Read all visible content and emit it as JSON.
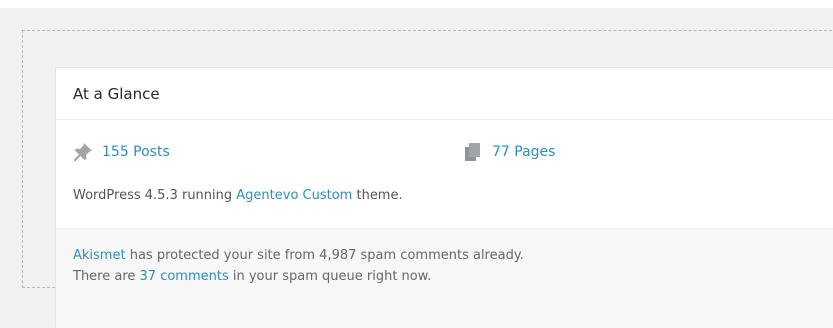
{
  "widget": {
    "title": "At a Glance",
    "posts": {
      "label": "155 Posts",
      "icon": "pushpin-icon"
    },
    "pages": {
      "label": "77 Pages",
      "icon": "pages-icon"
    },
    "version": {
      "prefix": "WordPress 4.5.3 running ",
      "theme_link": "Agentevo Custom",
      "suffix": " theme."
    },
    "akismet": {
      "line1_link": "Akismet",
      "line1_rest": " has protected your site from 4,987 spam comments already.",
      "line2_prefix": "There are ",
      "line2_link": "37 comments",
      "line2_suffix": " in your spam queue right now."
    }
  },
  "colors": {
    "link": "#2a8fbd",
    "background": "#f1f1f1",
    "panel": "#ffffff"
  }
}
